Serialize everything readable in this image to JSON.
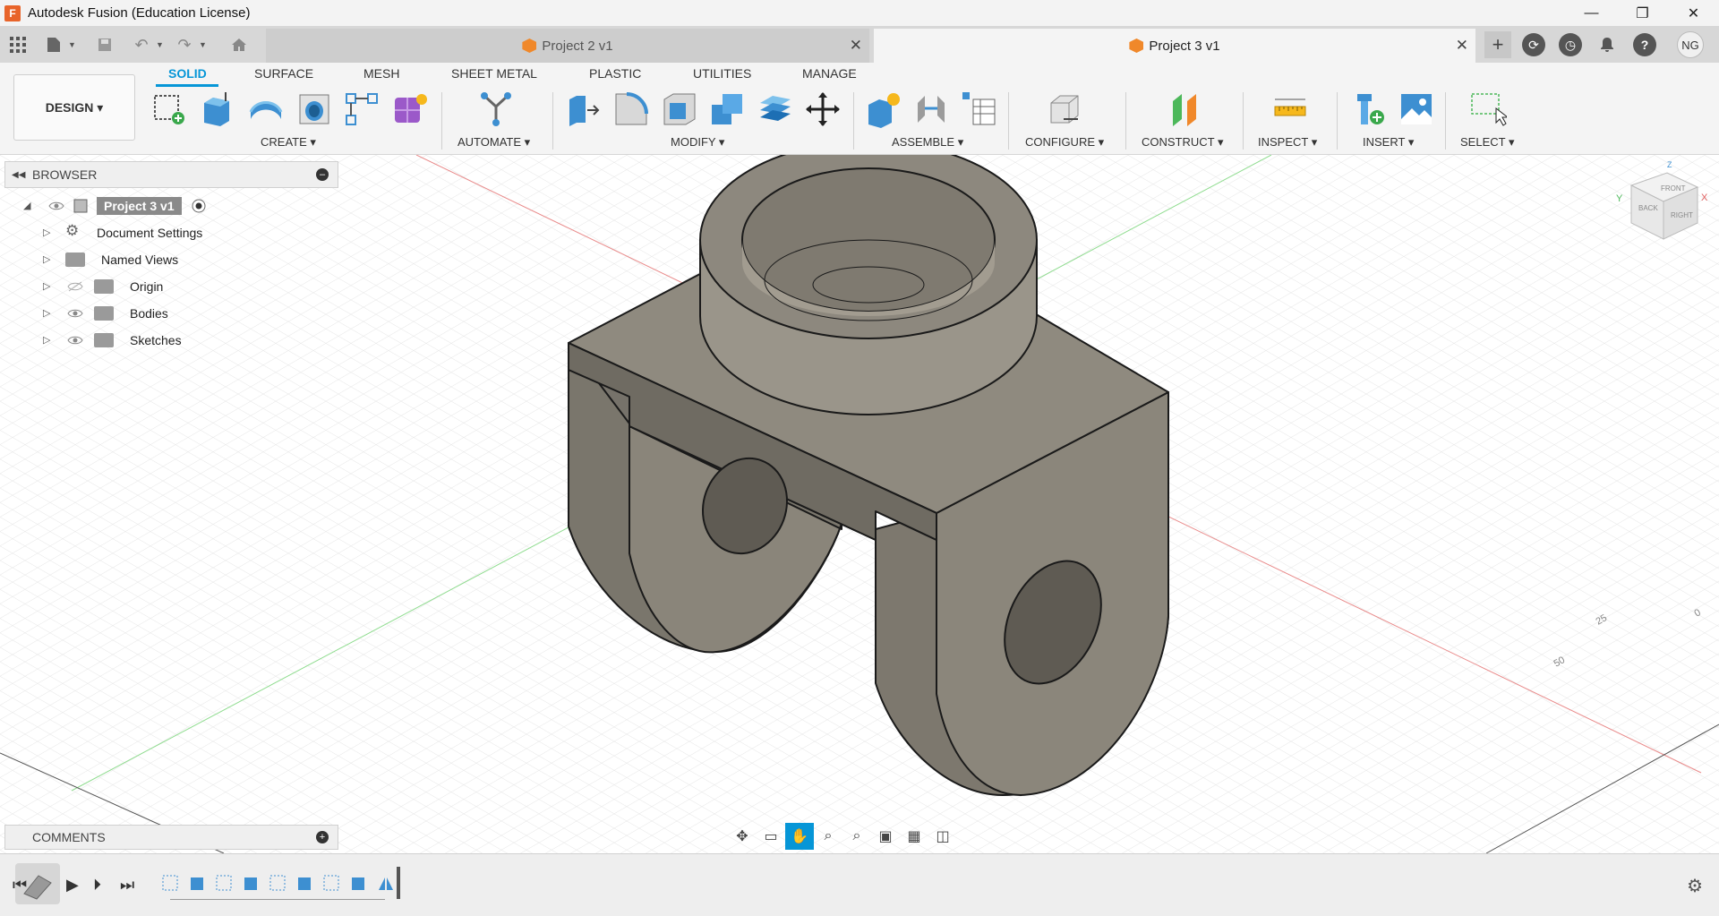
{
  "window": {
    "app_logo": "F",
    "title": "Autodesk Fusion (Education License)",
    "minimize": "—",
    "restore": "❐",
    "close": "✕"
  },
  "tabs": [
    {
      "label": "Project 2 v1",
      "active": false
    },
    {
      "label": "Project 3 v1",
      "active": true
    }
  ],
  "user_initials": "NG",
  "toolbar": {
    "design_label": "DESIGN ▾",
    "workspace_tabs": [
      "SOLID",
      "SURFACE",
      "MESH",
      "SHEET METAL",
      "PLASTIC",
      "UTILITIES",
      "MANAGE"
    ],
    "groups": [
      "CREATE ▾",
      "AUTOMATE ▾",
      "MODIFY ▾",
      "ASSEMBLE ▾",
      "CONFIGURE ▾",
      "CONSTRUCT ▾",
      "INSPECT ▾",
      "INSERT ▾",
      "SELECT ▾"
    ]
  },
  "browser": {
    "title": "BROWSER",
    "root": "Project 3 v1",
    "items": [
      "Document Settings",
      "Named Views",
      "Origin",
      "Bodies",
      "Sketches"
    ]
  },
  "comments": {
    "title": "COMMENTS"
  },
  "viewcube": {
    "front": "FRONT",
    "back": "BACK",
    "right": "RIGHT",
    "axis_x": "X",
    "axis_y": "Y",
    "axis_z": "Z"
  },
  "ruler": [
    "25",
    "50",
    "0"
  ],
  "colors": {
    "accent": "#0696d7",
    "model": "#7d786e",
    "x_axis": "#e06060",
    "y_axis": "#6fd36f"
  }
}
